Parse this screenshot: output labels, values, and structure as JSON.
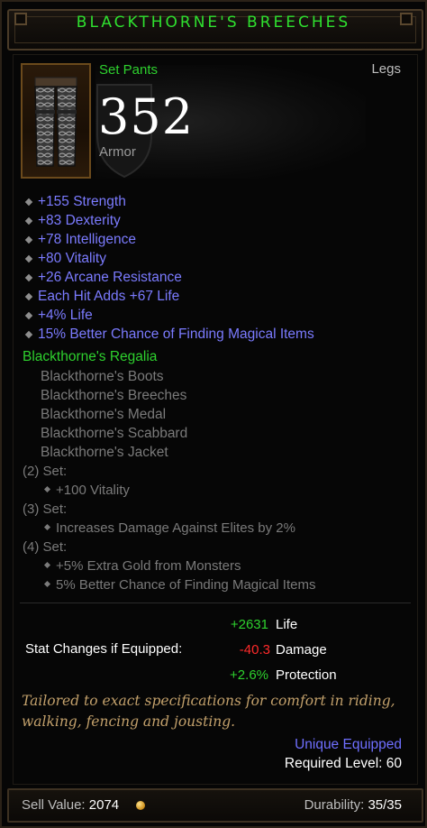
{
  "item": {
    "name": "BLACKTHORNE'S BREECHES",
    "type": "Set Pants",
    "slot": "Legs",
    "armor_value": "352",
    "armor_label": "Armor"
  },
  "affixes": [
    "+155 Strength",
    "+83 Dexterity",
    "+78 Intelligence",
    "+80 Vitality",
    "+26 Arcane Resistance",
    "Each Hit Adds +67 Life",
    "+4% Life",
    "15% Better Chance of Finding Magical Items"
  ],
  "set": {
    "name": "Blackthorne's Regalia",
    "items": [
      "Blackthorne's Boots",
      "Blackthorne's Breeches",
      "Blackthorne's Medal",
      "Blackthorne's Scabbard",
      "Blackthorne's Jacket"
    ],
    "bonus_2_header": "(2) Set:",
    "bonus_2": "+100 Vitality",
    "bonus_3_header": "(3) Set:",
    "bonus_3": "Increases Damage Against Elites by 2%",
    "bonus_4_header": "(4) Set:",
    "bonus_4": [
      "+5% Extra Gold from Monsters",
      "5% Better Chance of Finding Magical Items"
    ]
  },
  "stat_changes": {
    "label": "Stat Changes if Equipped:",
    "rows": [
      {
        "value": "+2631",
        "name": "Life",
        "color": "#2ed12e"
      },
      {
        "value": "-40.3",
        "name": "Damage",
        "color": "#ff2a2a"
      },
      {
        "value": "+2.6%",
        "name": "Protection",
        "color": "#2ed12e"
      }
    ]
  },
  "flavor": [
    "Tailored to exact specifications for comfort in riding,",
    "walking, fencing and jousting."
  ],
  "unique_equipped": "Unique Equipped",
  "required_level": "Required Level: 60",
  "footer": {
    "sell_label": "Sell Value:",
    "sell_value": "2074",
    "durability_label": "Durability:",
    "durability_value": "35/35"
  },
  "colors": {
    "set_green": "#2ed12e",
    "magic_blue": "#7b7bff",
    "flavor_gold": "#c2a06b",
    "negative_red": "#ff2a2a"
  },
  "icons": [
    "pants-icon",
    "shield-icon",
    "gold-coin-icon"
  ]
}
